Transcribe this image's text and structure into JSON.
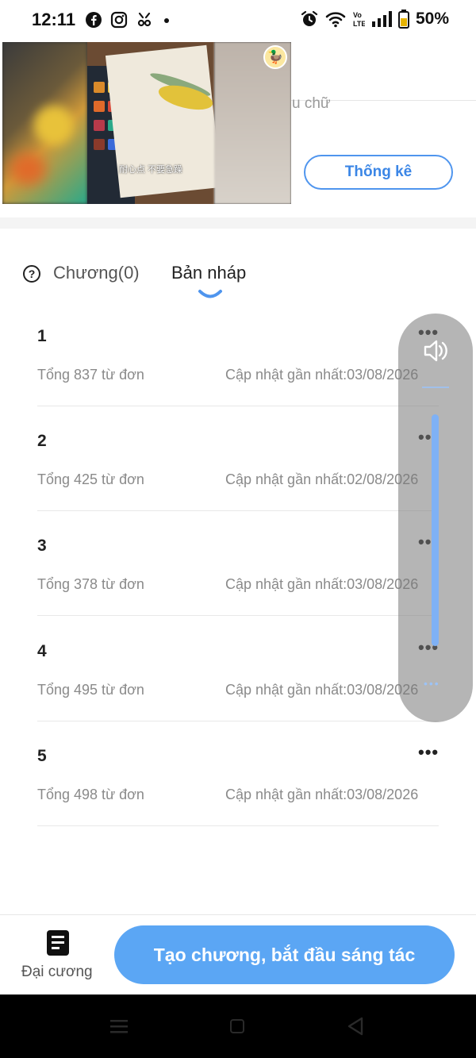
{
  "status_bar": {
    "time": "12:11",
    "battery": "50%",
    "icons": [
      "facebook-icon",
      "instagram-icon",
      "notification-icon",
      "dot-icon",
      "alarm-icon",
      "wifi-icon",
      "volte-icon",
      "signal-icon",
      "battery-icon"
    ]
  },
  "header": {
    "partial_text": "u chữ",
    "stats_button": "Thống kê"
  },
  "video_overlay": {
    "caption": "耐心点 不要急躁"
  },
  "tabs": {
    "chapters_label": "Chương(0)",
    "drafts_label": "Bản nháp",
    "active": "drafts"
  },
  "drafts": [
    {
      "number": "1",
      "count": "Tổng 837 từ đơn",
      "updated": "Cập nhật gần nhất:03/08/2026"
    },
    {
      "number": "2",
      "count": "Tổng 425 từ đơn",
      "updated": "Cập nhật gần nhất:02/08/2026"
    },
    {
      "number": "3",
      "count": "Tổng 378 từ đơn",
      "updated": "Cập nhật gần nhất:03/08/2026"
    },
    {
      "number": "4",
      "count": "Tổng 495 từ đơn",
      "updated": "Cập nhật gần nhất:03/08/2026"
    },
    {
      "number": "5",
      "count": "Tổng 498 từ đơn",
      "updated": "Cập nhật gần nhất:03/08/2026"
    }
  ],
  "more_label": "•••",
  "volume": {
    "icon": "speaker-icon"
  },
  "bottom": {
    "outline_label": "Đại cương",
    "create_button": "Tạo chương, bắt đầu sáng tác"
  },
  "colors": {
    "accent": "#4f95ee",
    "create_button_bg": "#5ba6f4",
    "muted_text": "#8a8a8a"
  }
}
